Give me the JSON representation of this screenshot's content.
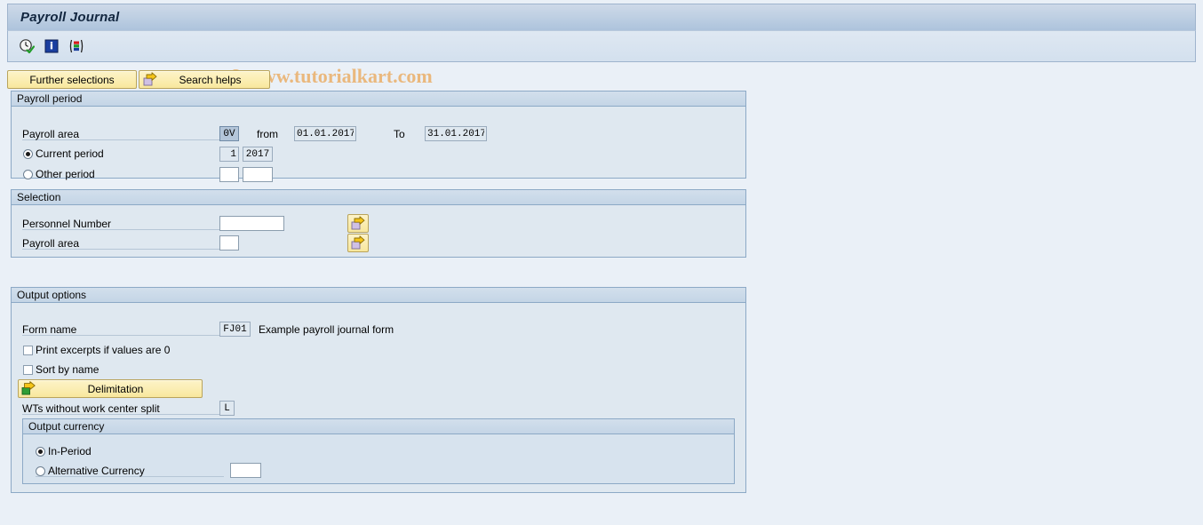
{
  "window": {
    "title": "Payroll Journal"
  },
  "watermark": {
    "text": "© www.tutorialkart.com"
  },
  "toolbar": {
    "items": [
      {
        "icon": "execute-clock-icon",
        "name": "execute-button"
      },
      {
        "icon": "info-icon",
        "name": "info-button"
      },
      {
        "icon": "variant-bars-icon",
        "name": "variants-button"
      }
    ]
  },
  "action_buttons": {
    "further_selections": "Further selections",
    "search_helps": "Search helps",
    "search_helps_icon": "arrow-right-icon"
  },
  "payroll_period": {
    "title": "Payroll period",
    "payroll_area_label": "Payroll area",
    "payroll_area_value": "0V",
    "from_label": "from",
    "from_value": "01.01.2017",
    "to_label": "To",
    "to_value": "31.01.2017",
    "current_period_label": "Current period",
    "current_period_selected": true,
    "current_period_num": "1",
    "current_period_year": "2017",
    "other_period_label": "Other period",
    "other_period_selected": false,
    "other_period_num": "",
    "other_period_year": ""
  },
  "selection": {
    "title": "Selection",
    "personnel_number_label": "Personnel Number",
    "personnel_number_value": "",
    "payroll_area_label": "Payroll area",
    "payroll_area_value": "",
    "multi_select_icon": "multiple-selection-icon"
  },
  "output_options": {
    "title": "Output options",
    "form_name_label": "Form name",
    "form_name_value": "FJ01",
    "form_name_description": "Example payroll journal form",
    "print_excerpts_label": "Print excerpts if values are 0",
    "print_excerpts_checked": false,
    "sort_by_name_label": "Sort by name",
    "sort_by_name_checked": false,
    "delimitation_label": "Delimitation",
    "delimitation_icon": "arrow-right-green-icon",
    "wts_label": "WTs without work center split",
    "wts_value": "L",
    "output_currency": {
      "title": "Output currency",
      "in_period_label": "In-Period",
      "in_period_selected": true,
      "alternative_currency_label": "Alternative Currency",
      "alternative_currency_selected": false,
      "alternative_currency_value": ""
    }
  },
  "colors": {
    "title_text": "#12263f",
    "panel_border": "#8ca9c6",
    "panel_body": "#dfe8f0",
    "button_yellow": "#f8e79c",
    "watermark": "#eab87d",
    "page_background": "#eaf0f7"
  }
}
